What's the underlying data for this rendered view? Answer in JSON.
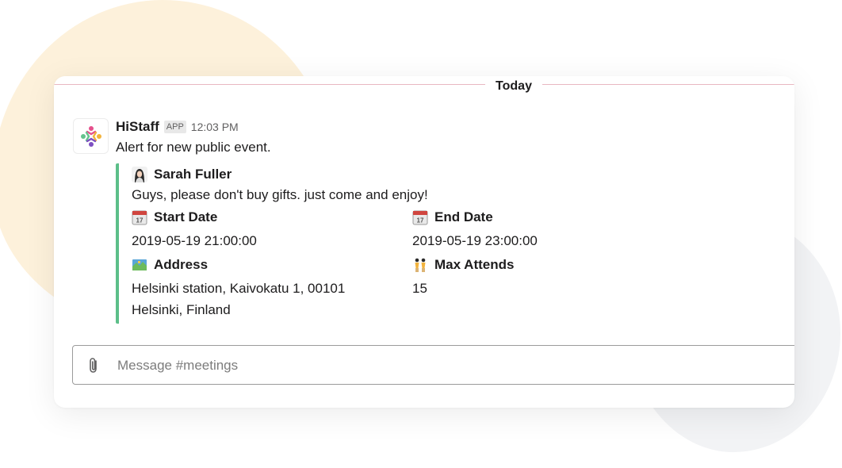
{
  "divider": {
    "label": "Today"
  },
  "message": {
    "sender": "HiStaff",
    "badge": "APP",
    "time": "12:03 PM",
    "text": "Alert for new public event.",
    "avatar_icon": "histaff-logo-icon"
  },
  "attachment": {
    "accent_color": "#5cbf89",
    "author": "Sarah Fuller",
    "text": "Guys, please don't buy gifts. just come and enjoy!",
    "fields": [
      {
        "title": "Start Date",
        "value": "2019-05-19 21:00:00",
        "icon": "calendar-icon"
      },
      {
        "title": "End Date",
        "value": "2019-05-19 23:00:00",
        "icon": "calendar-icon"
      },
      {
        "title": "Address",
        "value_lines": [
          "Helsinki station, Kaivokatu 1, 00101",
          "Helsinki, Finland"
        ],
        "icon": "map-icon"
      },
      {
        "title": "Max Attends",
        "value": "15",
        "icon": "dancers-icon"
      }
    ]
  },
  "composer": {
    "placeholder": "Message #meetings",
    "icon": "paperclip-icon"
  }
}
